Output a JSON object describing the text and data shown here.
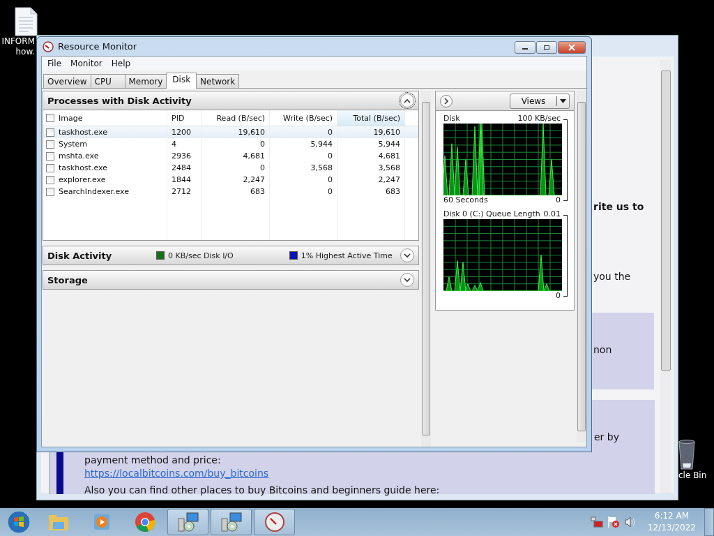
{
  "desktop_icons": [
    {
      "kind": "document",
      "lines": [
        "INFORM",
        "how."
      ]
    },
    {
      "kind": "recycle_bin",
      "lines": [
        "cle Bin"
      ]
    }
  ],
  "background_window": {
    "fragments": [
      {
        "text": "rite us to",
        "bold": true
      },
      {
        "text": "you the",
        "bold": false
      },
      {
        "text": "non",
        "bold": false
      },
      {
        "text": "er by",
        "bold": false
      }
    ],
    "lines": [
      {
        "kind": "text",
        "text": "payment method and price:"
      },
      {
        "kind": "link",
        "text": "https://localbitcoins.com/buy_bitcoins"
      },
      {
        "kind": "text",
        "text": "Also you can find other places to buy Bitcoins and beginners guide here:"
      }
    ]
  },
  "window": {
    "title": "Resource Monitor",
    "menu": [
      "File",
      "Monitor",
      "Help"
    ],
    "tabs": [
      {
        "label": "Overview",
        "selected": false
      },
      {
        "label": "CPU",
        "selected": false
      },
      {
        "label": "Memory",
        "selected": false
      },
      {
        "label": "Disk",
        "selected": true
      },
      {
        "label": "Network",
        "selected": false
      }
    ],
    "processes": {
      "title": "Processes with Disk Activity",
      "expanded": true,
      "columns": [
        {
          "label": "Image",
          "sorted": false
        },
        {
          "label": "PID",
          "sorted": false
        },
        {
          "label": "Read (B/sec)",
          "sorted": false
        },
        {
          "label": "Write (B/sec)",
          "sorted": false
        },
        {
          "label": "Total (B/sec)",
          "sorted": true
        }
      ],
      "rows": [
        {
          "checked": false,
          "selected": true,
          "cells": [
            "taskhost.exe",
            "1200",
            "19,610",
            "0",
            "19,610"
          ]
        },
        {
          "checked": false,
          "selected": false,
          "cells": [
            "System",
            "4",
            "0",
            "5,944",
            "5,944"
          ]
        },
        {
          "checked": false,
          "selected": false,
          "cells": [
            "mshta.exe",
            "2936",
            "4,681",
            "0",
            "4,681"
          ]
        },
        {
          "checked": false,
          "selected": false,
          "cells": [
            "taskhost.exe",
            "2484",
            "0",
            "3,568",
            "3,568"
          ]
        },
        {
          "checked": false,
          "selected": false,
          "cells": [
            "explorer.exe",
            "1844",
            "2,247",
            "0",
            "2,247"
          ]
        },
        {
          "checked": false,
          "selected": false,
          "cells": [
            "SearchIndexer.exe",
            "2712",
            "683",
            "0",
            "683"
          ]
        }
      ]
    },
    "disk_activity": {
      "title": "Disk Activity",
      "expanded": false,
      "legend": [
        {
          "label": "0 KB/sec Disk I/O",
          "color": "#1a6e1a"
        },
        {
          "label": "1% Highest Active Time",
          "color": "#0a14b4"
        }
      ]
    },
    "storage": {
      "title": "Storage",
      "expanded": false
    },
    "views_button": "Views",
    "graphs": [
      {
        "title": "Disk",
        "max": "100 KB/sec",
        "footer": "60 Seconds",
        "min": "0"
      },
      {
        "title": "Disk 0 (C:) Queue Length",
        "max": "0.01",
        "min": "0"
      }
    ]
  },
  "taskbar": {
    "apps": [
      {
        "kind": "explorer",
        "active": false
      },
      {
        "kind": "media",
        "active": false
      },
      {
        "kind": "chrome",
        "active": false
      },
      {
        "kind": "setup",
        "active": true
      },
      {
        "kind": "setup",
        "active": true
      },
      {
        "kind": "gauge",
        "active": true
      }
    ],
    "time": "6:12 AM",
    "date": "12/13/2022"
  }
}
